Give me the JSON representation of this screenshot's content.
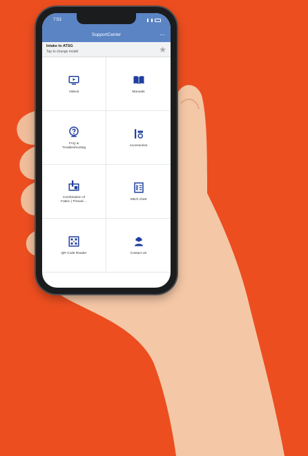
{
  "colors": {
    "background": "#ec4e20",
    "header": "#5b84c4",
    "accent": "#1f3f9e"
  },
  "status_bar": {
    "time": "7:53"
  },
  "nav": {
    "title": "SupportCenter",
    "menu_icon": "more-icon"
  },
  "model": {
    "name": "Intake to ATSG",
    "hint": "Tap to change model",
    "favorite_icon": "star-icon"
  },
  "tiles": [
    {
      "label": "Videos",
      "icon": "video-icon"
    },
    {
      "label": "Manuals",
      "icon": "book-icon"
    },
    {
      "label": "FAQ &\nTroubleshooting",
      "icon": "help-icon"
    },
    {
      "label": "Accessories",
      "icon": "accessories-icon"
    },
    {
      "label": "Combination of\nFabric | Thread ...",
      "icon": "combination-icon"
    },
    {
      "label": "Stitch chart",
      "icon": "stitch-chart-icon"
    },
    {
      "label": "QR Code Reader",
      "icon": "qr-code-icon"
    },
    {
      "label": "Contact Us",
      "icon": "contact-icon"
    }
  ]
}
